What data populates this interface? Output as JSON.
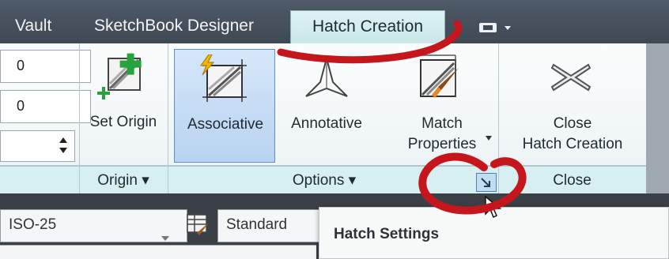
{
  "tabs": {
    "vault": "Vault",
    "sketchbook": "SketchBook Designer",
    "hatch": "Hatch Creation"
  },
  "fields": {
    "value1": "0",
    "value2": "0"
  },
  "buttons": {
    "set_origin": "Set Origin",
    "associative": "Associative",
    "annotative": "Annotative",
    "match_properties_line1": "Match",
    "match_properties_line2": "Properties",
    "close_line1": "Close",
    "close_line2": "Hatch Creation"
  },
  "panels": {
    "origin": "Origin ▾",
    "options": "Options ▾",
    "close": "Close"
  },
  "bottom": {
    "dimstyle": "ISO-25",
    "textstyle": "Standard"
  },
  "tooltip": {
    "title": "Hatch Settings"
  },
  "colors": {
    "annotation": "#c4161c",
    "selected_button": "#c7dcf3",
    "ribbon_footer": "#d7eff1"
  }
}
